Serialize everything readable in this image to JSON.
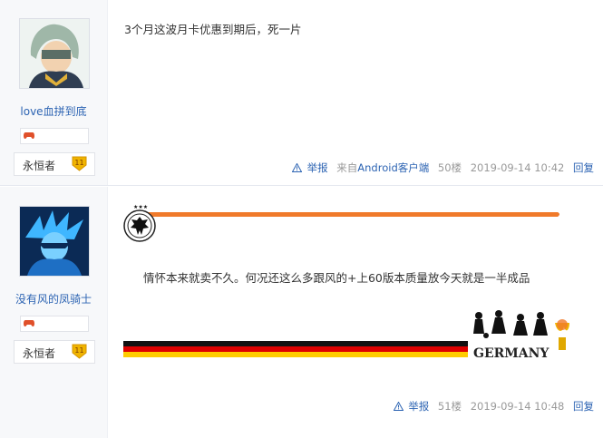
{
  "posts": [
    {
      "username": "love血拼到底",
      "level_title": "永恒者",
      "level_number": "11",
      "content": "3个月这波月卡优惠到期后，死一片",
      "report_label": "举报",
      "source_prefix": "来自",
      "source_link": "Android客户端",
      "floor": "50楼",
      "time": "2019-09-14 10:42",
      "reply_label": "回复"
    },
    {
      "username": "没有风的凤骑士",
      "level_title": "永恒者",
      "level_number": "11",
      "content": "情怀本来就卖不久。何况还这么多跟风的+上60版本质量放今天就是一半成品",
      "signature_text": "GERMANY",
      "report_label": "举报",
      "floor": "51楼",
      "time": "2019-09-14 10:48",
      "reply_label": "回复"
    }
  ],
  "colors": {
    "link_blue": "#2d64b3",
    "badge_gold": "#f0b400",
    "orange_bar": "#f07a2a",
    "flag_black": "#111111",
    "flag_red": "#dd0000",
    "flag_gold": "#ffcc00"
  }
}
